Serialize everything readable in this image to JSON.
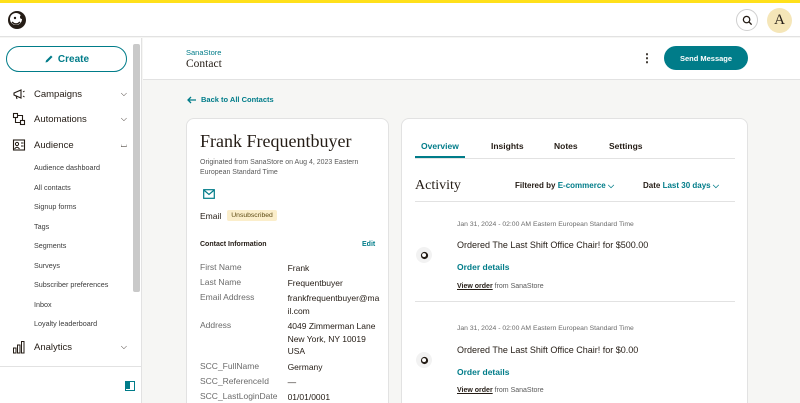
{
  "app": {
    "brand_color": "#ffe01b",
    "accent": "#007c89",
    "avatar_initial": "A"
  },
  "sidebar": {
    "create_label": "Create",
    "items": [
      {
        "label": "Campaigns",
        "icon": "megaphone-icon"
      },
      {
        "label": "Automations",
        "icon": "automation-icon"
      },
      {
        "label": "Audience",
        "icon": "audience-icon"
      },
      {
        "label": "Analytics",
        "icon": "bar-chart-icon"
      }
    ],
    "audience_sub": [
      "Audience dashboard",
      "All contacts",
      "Signup forms",
      "Tags",
      "Segments",
      "Surveys",
      "Subscriber preferences",
      "Inbox",
      "Loyalty leaderboard"
    ]
  },
  "header": {
    "breadcrumb": "SanaStore",
    "title": "Contact",
    "send_label": "Send Message"
  },
  "back_link": "Back to All Contacts",
  "profile": {
    "name": "Frank Frequentbuyer",
    "originated": "Originated from SanaStore on Aug 4, 2023 Eastern European Standard Time",
    "email_label": "Email",
    "email_status": "Unsubscribed",
    "contact_info_title": "Contact Information",
    "edit_label": "Edit",
    "fields": [
      {
        "key": "First Name",
        "value": "Frank"
      },
      {
        "key": "Last Name",
        "value": "Frequentbuyer"
      },
      {
        "key": "Email Address",
        "value": "frankfrequentbuyer@mail.com"
      },
      {
        "key": "Address",
        "value": "4049 Zimmerman Lane New York, NY 10019 USA"
      },
      {
        "key": "SCC_FullName",
        "value": "Germany"
      },
      {
        "key": "SCC_ReferenceId",
        "value": "—"
      },
      {
        "key": "SCC_LastLoginDate",
        "value": "01/01/0001"
      }
    ]
  },
  "activity": {
    "tabs": [
      "Overview",
      "Insights",
      "Notes",
      "Settings"
    ],
    "title": "Activity",
    "filter_label": "Filtered by",
    "filter_value": "E-commerce",
    "date_label": "Date",
    "date_value": "Last 30 days",
    "feed": [
      {
        "date": "Jan 31, 2024 - 02:00 AM Eastern European Standard Time",
        "text": "Ordered The Last Shift Office Chair! for $500.00",
        "details": "Order details",
        "view_order": "View order",
        "from": "from SanaStore"
      },
      {
        "date": "Jan 31, 2024 - 02:00 AM Eastern European Standard Time",
        "text": "Ordered The Last Shift Office Chair! for $0.00",
        "details": "Order details",
        "view_order": "View order",
        "from": "from SanaStore"
      }
    ]
  }
}
